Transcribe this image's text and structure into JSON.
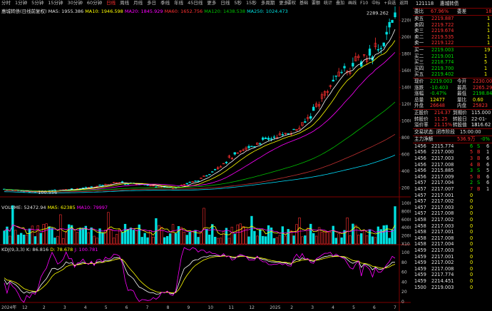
{
  "toolbar": {
    "items": [
      "分时",
      "1分钟",
      "5分钟",
      "15分钟",
      "30分钟",
      "60分钟",
      "日线",
      "周线",
      "月线",
      "多日",
      "季线",
      "年线",
      "45日线",
      "更多",
      "日线",
      "5秒",
      "15秒",
      "多周期",
      "更多"
    ],
    "active_index": 6,
    "right_items": [
      "要权",
      "基础",
      "要额",
      "统计",
      "叠加",
      "画线",
      "F10",
      "中标",
      "+自选",
      "返回"
    ]
  },
  "main_legend": {
    "name": "惠城转债(日线前复权)",
    "ma5": "MA5: 1955.386",
    "ma10": "MA10: 1946.598",
    "ma20": "MA20: 1845.929",
    "ma60": "MA60: 1652.756",
    "ma120": "MA120: 1438.538",
    "ma250": "MA250: 1024.473"
  },
  "price_axis": [
    "2200",
    "2000",
    "1800",
    "1600",
    "1400",
    "1200",
    "1000",
    "800",
    "600",
    "400",
    "200"
  ],
  "annotations": {
    "high_label": "2289.262",
    "low_label": "100.556"
  },
  "volume_legend": {
    "title": "VOLUME: 52472.94",
    "ma5": "MA5: 62385",
    "ma10": "MA10: 79997"
  },
  "volume_axis": [
    "10000",
    "8000",
    "6000",
    "4000",
    "2000",
    "X10"
  ],
  "kdj_legend": {
    "title": "KDJ(9,3,3)",
    "k": "K: 86.816",
    "d": "D: 78.678",
    "j": "J: 100.781"
  },
  "kdj_axis": [
    "100",
    "80",
    "60",
    "40",
    "20",
    "0"
  ],
  "date_axis": [
    "2024年",
    "12",
    "2",
    "3",
    "4",
    "5",
    "6",
    "7",
    "8",
    "9",
    "10",
    "11",
    "12",
    "2025",
    "2",
    "3",
    "4",
    "5",
    "6",
    "7"
  ],
  "right_panel": {
    "code": "121118",
    "name": "惠城转债",
    "weibi_label": "委比",
    "weibi": "67.96%",
    "weicha_label": "委差",
    "weicha": "18",
    "sells": [
      {
        "label": "卖五",
        "price": "2219.887",
        "vol": "1"
      },
      {
        "label": "卖四",
        "price": "2219.722",
        "vol": "1"
      },
      {
        "label": "卖三",
        "price": "2219.674",
        "vol": "1"
      },
      {
        "label": "卖二",
        "price": "2219.535",
        "vol": "1"
      },
      {
        "label": "卖一",
        "price": "2219.122",
        "vol": "1"
      }
    ],
    "buys": [
      {
        "label": "买一",
        "price": "2219.003",
        "vol": "19"
      },
      {
        "label": "买二",
        "price": "2219.001",
        "vol": "1"
      },
      {
        "label": "买三",
        "price": "2218.774",
        "vol": "5"
      },
      {
        "label": "买四",
        "price": "2219.700",
        "vol": "1"
      },
      {
        "label": "买五",
        "price": "2219.402",
        "vol": "1"
      }
    ],
    "stats": [
      {
        "l1": "现价",
        "v1": "2219.003",
        "l2": "今开",
        "v2": "2230.000"
      },
      {
        "l1": "涨跌",
        "v1": "-10.403",
        "l2": "最高",
        "v2": "2265.293"
      },
      {
        "l1": "涨幅",
        "v1": "-0.47%",
        "l2": "最低",
        "v2": "2198.849"
      },
      {
        "l1": "总量",
        "v1": "12477",
        "l2": "量比",
        "v2": "0.60"
      },
      {
        "l1": "外盘",
        "v1": "26648",
        "l2": "内盘",
        "v2": "25823"
      }
    ],
    "extra": [
      {
        "l1": "正股价",
        "v1": "214.37",
        "l2": "到期价",
        "v2": "115.000"
      },
      {
        "l1": "转股价",
        "v1": "11.25",
        "l2": "转股日",
        "v2": "22-01-13"
      },
      {
        "l1": "溢价率",
        "v1": "21.15%",
        "l2": "转股值",
        "v2": "1816.62"
      }
    ],
    "trade_status_label": "交易状态: 闭市阶段",
    "trade_status_time": "15:00:00",
    "main_inflow_label": "主力净额",
    "main_inflow": "536.9万",
    "main_inflow_pct": "-0%",
    "ticks": [
      {
        "t": "1456",
        "p": "2215.774",
        "v": "6",
        "d": "S",
        "n": "6"
      },
      {
        "t": "1456",
        "p": "2217.000",
        "v": "5",
        "d": "B",
        "n": "1"
      },
      {
        "t": "1456",
        "p": "2217.003",
        "v": "3",
        "d": "B",
        "n": "6"
      },
      {
        "t": "1456",
        "p": "2217.008",
        "v": "4",
        "d": "B",
        "n": "6"
      },
      {
        "t": "1456",
        "p": "2215.885",
        "v": "3",
        "d": "S",
        "n": "5"
      },
      {
        "t": "1456",
        "p": "2217.009",
        "v": "5",
        "d": "B",
        "n": "6"
      },
      {
        "t": "1457",
        "p": "2217.004",
        "v": "2",
        "d": "S",
        "n": "6"
      },
      {
        "t": "1457",
        "p": "2217.007",
        "v": "7",
        "d": "B",
        "n": "1"
      },
      {
        "t": "1457",
        "p": "2217.001",
        "v": "0",
        "d": "",
        "n": ""
      },
      {
        "t": "1457",
        "p": "2217.002",
        "v": "0",
        "d": "",
        "n": ""
      },
      {
        "t": "1457",
        "p": "2217.003",
        "v": "0",
        "d": "",
        "n": ""
      },
      {
        "t": "1457",
        "p": "2217.008",
        "v": "0",
        "d": "",
        "n": ""
      },
      {
        "t": "1458",
        "p": "2217.002",
        "v": "0",
        "d": "",
        "n": ""
      },
      {
        "t": "1458",
        "p": "2217.003",
        "v": "0",
        "d": "",
        "n": ""
      },
      {
        "t": "1458",
        "p": "2217.001",
        "v": "0",
        "d": "",
        "n": ""
      },
      {
        "t": "1458",
        "p": "2217.008",
        "v": "0",
        "d": "",
        "n": ""
      },
      {
        "t": "1458",
        "p": "2217.004",
        "v": "0",
        "d": "",
        "n": ""
      },
      {
        "t": "1459",
        "p": "2217.003",
        "v": "0",
        "d": "",
        "n": ""
      },
      {
        "t": "1459",
        "p": "2217.001",
        "v": "0",
        "d": "",
        "n": ""
      },
      {
        "t": "1459",
        "p": "2217.002",
        "v": "0",
        "d": "",
        "n": ""
      },
      {
        "t": "1459",
        "p": "2217.008",
        "v": "0",
        "d": "",
        "n": ""
      },
      {
        "t": "1459",
        "p": "2217.774",
        "v": "0",
        "d": "",
        "n": ""
      },
      {
        "t": "1459",
        "p": "2214.451",
        "v": "0",
        "d": "",
        "n": ""
      },
      {
        "t": "1500",
        "p": "2219.003",
        "v": "0",
        "d": "",
        "n": ""
      }
    ]
  },
  "colors": {
    "up": "#ff3030",
    "down": "#00e0e0",
    "ma5": "#ffffff",
    "ma10": "#ffff00",
    "ma20": "#ff00ff",
    "ma60": "#00c000",
    "ma120": "#c03030",
    "ma250": "#00e0ff",
    "grid": "#800000"
  }
}
